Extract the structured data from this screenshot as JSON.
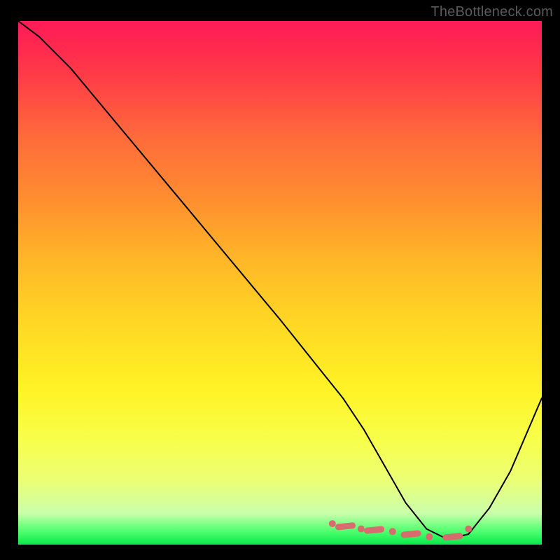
{
  "watermark": "TheBottleneck.com",
  "colors": {
    "page_bg": "#000000",
    "gradient_top": "#ff1a57",
    "gradient_bottom": "#08e84a",
    "curve": "#000000",
    "markers": "#d86b6e",
    "watermark": "#5a5a5a"
  },
  "chart_data": {
    "type": "line",
    "title": "",
    "xlabel": "",
    "ylabel": "",
    "xlim": [
      0,
      100
    ],
    "ylim": [
      0,
      100
    ],
    "x": [
      0,
      4,
      10,
      20,
      30,
      40,
      50,
      58,
      62,
      66,
      70,
      74,
      78,
      82,
      86,
      90,
      94,
      100
    ],
    "y": [
      100,
      97,
      91,
      79,
      67,
      55,
      43,
      33,
      28,
      22,
      15,
      8,
      3,
      1,
      2,
      7,
      14,
      28
    ],
    "markers": {
      "note": "dots and dashes near the trough",
      "points_x": [
        60,
        62.5,
        65.5,
        68,
        71.5,
        75,
        78.5,
        83,
        86
      ],
      "points_y": [
        4,
        3.5,
        3,
        2.8,
        2.5,
        2,
        1.5,
        1.5,
        3
      ]
    },
    "minimum": {
      "x": 82,
      "y": 1
    }
  }
}
